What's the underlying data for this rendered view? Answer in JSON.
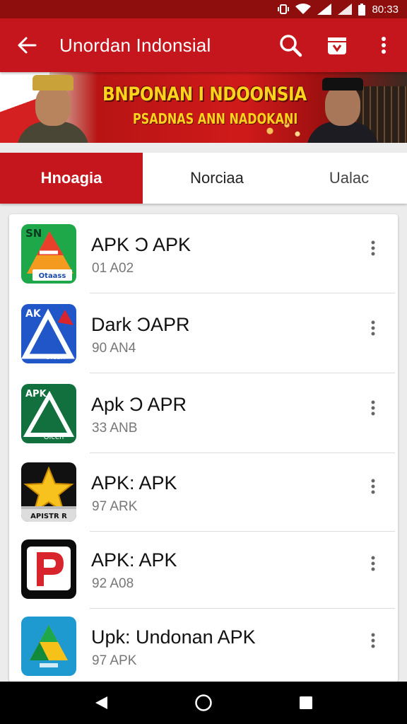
{
  "status_bar": {
    "time": "80:33"
  },
  "app_bar": {
    "title": "Unordan Indonsial"
  },
  "banner": {
    "headline": "BNPONAN I NDOONSIA",
    "subline": "PSADNAS ANN NADOKANI"
  },
  "tabs": [
    {
      "label": "Hnoagia",
      "active": true
    },
    {
      "label": "Norciaa",
      "active": false
    },
    {
      "label": "Ualac",
      "active": false
    }
  ],
  "apps": [
    {
      "name": "APK Ɔ APK",
      "size": "01 A02",
      "icon": "apk-green-orange-icon",
      "icon_text": "SN",
      "icon_sub": "Otaass"
    },
    {
      "name": "Dark ƆAPR",
      "size": "90 AN4",
      "icon": "apk-blue-icon",
      "icon_text": "AK",
      "icon_sub": "Olcan"
    },
    {
      "name": "Apk Ɔ APR",
      "size": "33 ANB",
      "icon": "apk-dark-green-icon",
      "icon_text": "APK",
      "icon_sub": "Oicen"
    },
    {
      "name": "APK: APK",
      "size": "97 ARK",
      "icon": "star-icon",
      "icon_text": "",
      "icon_sub": "APISTR R"
    },
    {
      "name": "APK: APK",
      "size": "92 A08",
      "icon": "p-logo-icon",
      "icon_text": "",
      "icon_sub": ""
    },
    {
      "name": "Upk: Undonan APK",
      "size": "97 APK",
      "icon": "drive-triangle-icon",
      "icon_text": "",
      "icon_sub": ""
    }
  ],
  "colors": {
    "primary": "#c4161c",
    "status_bar": "#8e0d0d",
    "nav_bar": "#000000"
  }
}
